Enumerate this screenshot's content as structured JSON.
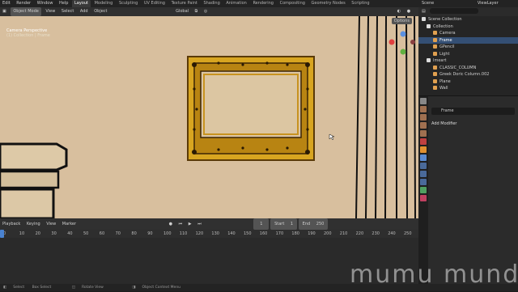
{
  "topbar": {
    "menus": [
      "Edit",
      "Render",
      "Window",
      "Help"
    ],
    "workspace_tabs": [
      "Layout",
      "Modeling",
      "Sculpting",
      "UV Editing",
      "Texture Paint",
      "Shading",
      "Animation",
      "Rendering",
      "Compositing",
      "Geometry Nodes",
      "Scripting"
    ],
    "active_tab": "Layout",
    "scene": "Scene",
    "view_layer": "ViewLayer"
  },
  "viewport_header": {
    "mode": "Object Mode",
    "menus": [
      "View",
      "Select",
      "Add",
      "Object"
    ],
    "orientation": "Global",
    "options": "Options"
  },
  "viewport": {
    "camera_label": "Camera Perspective",
    "collection_label": "(1) Collection | Frame"
  },
  "outliner": {
    "search_placeholder": "",
    "items": [
      {
        "label": "Scene Collection",
        "depth": 0,
        "color": "#ffffff"
      },
      {
        "label": "Collection",
        "depth": 1,
        "color": "#ffffff"
      },
      {
        "label": "Camera",
        "depth": 2,
        "color": "#e0a050"
      },
      {
        "label": "Frame",
        "depth": 2,
        "color": "#e0a050",
        "selected": true
      },
      {
        "label": "GPencil",
        "depth": 2,
        "color": "#e0a050"
      },
      {
        "label": "Light",
        "depth": 2,
        "color": "#e0a050"
      },
      {
        "label": "Imeart",
        "depth": 1,
        "color": "#ffffff"
      },
      {
        "label": "CLASSIC_COLUMN",
        "depth": 2,
        "color": "#e0a050"
      },
      {
        "label": "Greek Doric Column.002",
        "depth": 2,
        "color": "#e0a050"
      },
      {
        "label": "Plane",
        "depth": 2,
        "color": "#e0a050"
      },
      {
        "label": "Wall",
        "depth": 2,
        "color": "#e0a050"
      }
    ]
  },
  "properties": {
    "object_name": "Frame",
    "add_modifier": "Add Modifier"
  },
  "timeline": {
    "menus": [
      "Playback",
      "Keying",
      "View",
      "Marker"
    ],
    "current_frame": "1",
    "start_label": "Start",
    "start": "1",
    "end_label": "End",
    "end": "250",
    "ruler": [
      "0",
      "10",
      "20",
      "30",
      "40",
      "50",
      "60",
      "70",
      "80",
      "90",
      "100",
      "110",
      "120",
      "130",
      "140",
      "150",
      "160",
      "170",
      "180",
      "190",
      "200",
      "210",
      "220",
      "230",
      "240",
      "250"
    ]
  },
  "statusbar": {
    "items": [
      "Select",
      "Box Select",
      "Rotate View",
      "Object Context Menu"
    ]
  },
  "watermark": "mumu mund",
  "colors": {
    "wall": "#d8bf9e",
    "frame_gold": "#d8a520",
    "selection": "#344f74"
  }
}
